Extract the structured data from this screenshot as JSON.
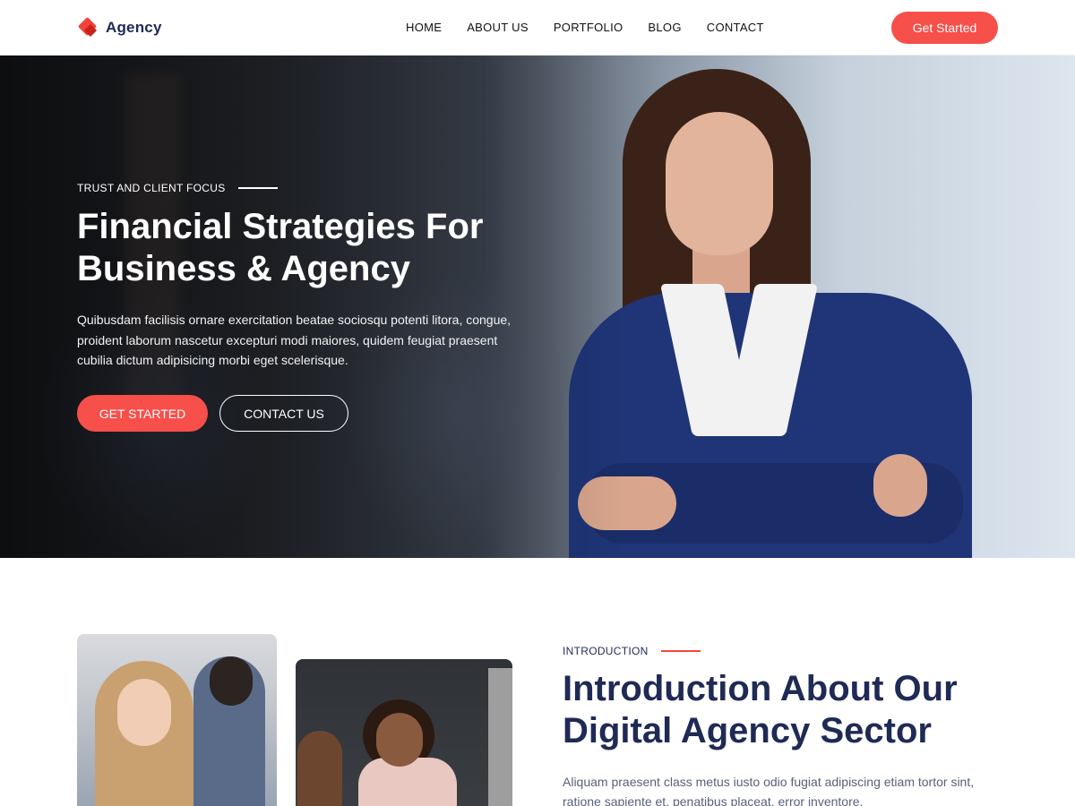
{
  "header": {
    "logo_text": "Agency",
    "nav": [
      "HOME",
      "ABOUT US",
      "PORTFOLIO",
      "BLOG",
      "CONTACT"
    ],
    "cta_label": "Get Started"
  },
  "hero": {
    "eyebrow": "TRUST AND CLIENT FOCUS",
    "title": "Financial Strategies For Business & Agency",
    "text": "Quibusdam facilisis ornare exercitation beatae sociosqu potenti litora, congue, proident laborum nascetur excepturi modi maiores, quidem feugiat praesent cubilia dictum adipisicing morbi eget scelerisque.",
    "primary_label": "GET STARTED",
    "secondary_label": "CONTACT US"
  },
  "intro": {
    "eyebrow": "INTRODUCTION",
    "title": "Introduction About Our Digital Agency Sector",
    "text": "Aliquam praesent class metus iusto odio fugiat adipiscing etiam tortor sint, ratione sapiente et, penatibus placeat, error inventore."
  },
  "colors": {
    "accent": "#f74f4a",
    "navy": "#1f2a55"
  }
}
